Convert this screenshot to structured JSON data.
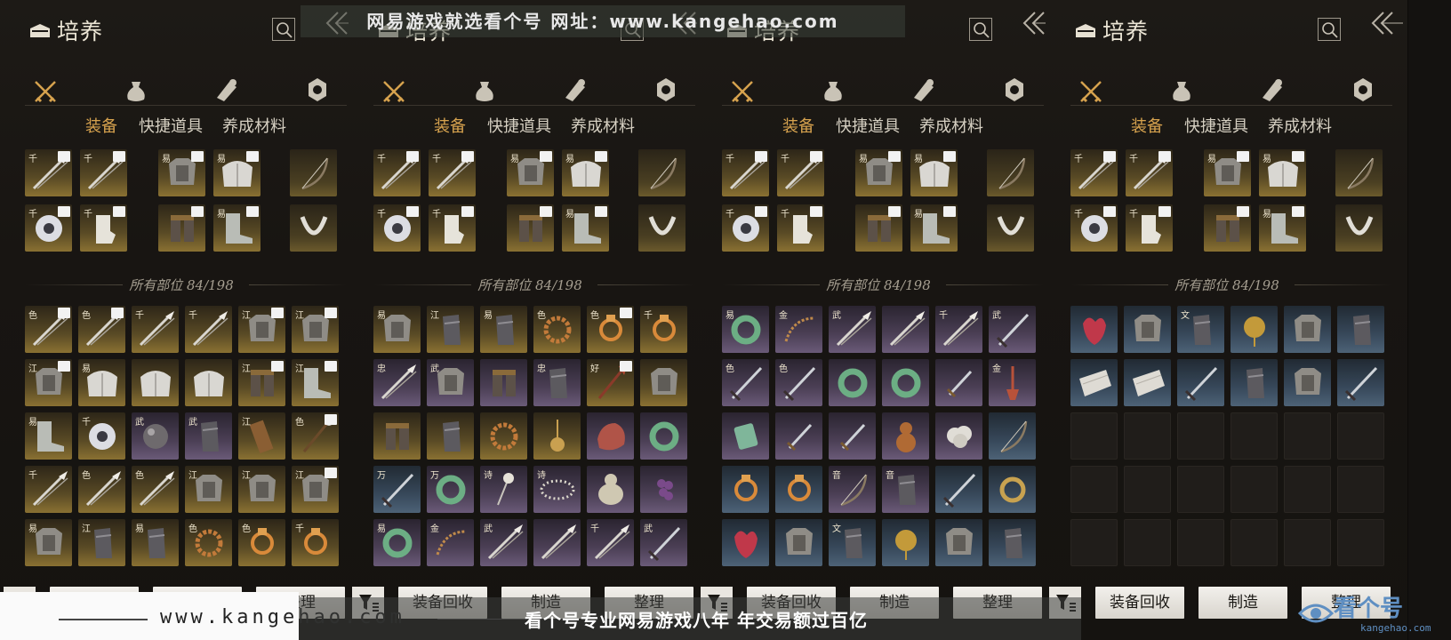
{
  "header": {
    "title": "培养"
  },
  "tabs": [
    "装备",
    "快捷道具",
    "养成材料"
  ],
  "active_tab": "装备",
  "slots_count": "所有部位 84/198",
  "buttons": {
    "recycle": "装备回收",
    "craft": "制造",
    "sort": "整理"
  },
  "watermarks": {
    "top": "网易游戏就选看个号   网址：www.kangehao.com",
    "url": "www.kangehao.com",
    "slogan": "看个号专业网易游戏八年  年交易额过百亿",
    "logo": "看个号",
    "logo_sub": "kangehao.com"
  },
  "category_icons": [
    "crossed-swords-icon",
    "pouch-icon",
    "scroll-icon",
    "coin-medal-icon"
  ],
  "equipped": [
    {
      "tag": "千",
      "item": "spear",
      "q": "gold",
      "lv": true
    },
    {
      "tag": "千",
      "item": "spear",
      "q": "gold",
      "lv": true
    },
    {
      "tag": "易",
      "item": "armor",
      "q": "gold",
      "lv": true
    },
    {
      "tag": "易",
      "item": "chest",
      "q": "gold",
      "lv": true
    },
    {
      "tag": "",
      "item": "bow",
      "q": "gold-dim",
      "lv": false
    },
    {
      "tag": "千",
      "item": "disc",
      "q": "gold",
      "lv": true
    },
    {
      "tag": "千",
      "item": "glove",
      "q": "gold",
      "lv": true
    },
    {
      "tag": "",
      "item": "legs",
      "q": "gold",
      "lv": true
    },
    {
      "tag": "易",
      "item": "boot",
      "q": "gold",
      "lv": true
    },
    {
      "tag": "",
      "item": "necklace",
      "q": "gold-dim",
      "lv": false
    }
  ],
  "inventory": [
    [
      {
        "tag": "色",
        "item": "spear",
        "q": "gold",
        "lv": true
      },
      {
        "tag": "色",
        "item": "spear",
        "q": "gold",
        "lv": true
      },
      {
        "tag": "千",
        "item": "spear",
        "q": "gold",
        "lv": false
      },
      {
        "tag": "千",
        "item": "spear",
        "q": "gold",
        "lv": false
      },
      {
        "tag": "江",
        "item": "armor",
        "q": "gold",
        "lv": true
      },
      {
        "tag": "江",
        "item": "armor",
        "q": "gold",
        "lv": true
      },
      {
        "tag": "江",
        "item": "armor",
        "q": "gold",
        "lv": true
      },
      {
        "tag": "易",
        "item": "chest",
        "q": "gold",
        "lv": false
      },
      {
        "tag": "",
        "item": "chest",
        "q": "gold",
        "lv": false
      },
      {
        "tag": "",
        "item": "chest",
        "q": "gold",
        "lv": false
      },
      {
        "tag": "江",
        "item": "legs",
        "q": "gold",
        "lv": true
      },
      {
        "tag": "江",
        "item": "boot",
        "q": "gold",
        "lv": true
      },
      {
        "tag": "易",
        "item": "boot",
        "q": "gold",
        "lv": false
      },
      {
        "tag": "千",
        "item": "disc",
        "q": "gold",
        "lv": false
      },
      {
        "tag": "武",
        "item": "orb",
        "q": "purple",
        "lv": false
      },
      {
        "tag": "武",
        "item": "bracer",
        "q": "purple",
        "lv": false
      },
      {
        "tag": "江",
        "item": "quiver",
        "q": "gold",
        "lv": false
      },
      {
        "tag": "色",
        "item": "staff",
        "q": "gold",
        "lv": true
      },
      {
        "tag": "千",
        "item": "spear",
        "q": "gold",
        "lv": false
      },
      {
        "tag": "色",
        "item": "spear",
        "q": "gold",
        "lv": false
      },
      {
        "tag": "色",
        "item": "spear",
        "q": "gold",
        "lv": false
      },
      {
        "tag": "江",
        "item": "armor",
        "q": "gold",
        "lv": false
      },
      {
        "tag": "江",
        "item": "armor",
        "q": "gold",
        "lv": false
      },
      {
        "tag": "江",
        "item": "armor",
        "q": "gold",
        "lv": true
      },
      {
        "tag": "易",
        "item": "armor",
        "q": "gold",
        "lv": false
      },
      {
        "tag": "江",
        "item": "bracer",
        "q": "gold",
        "lv": false
      },
      {
        "tag": "易",
        "item": "bracer",
        "q": "gold",
        "lv": false
      },
      {
        "tag": "色",
        "item": "bead",
        "q": "gold",
        "lv": false
      },
      {
        "tag": "色",
        "item": "ring",
        "q": "gold",
        "lv": false
      },
      {
        "tag": "千",
        "item": "ring",
        "q": "gold",
        "lv": false
      }
    ],
    [
      {
        "tag": "易",
        "item": "armor",
        "q": "gold",
        "lv": false
      },
      {
        "tag": "江",
        "item": "bracer",
        "q": "gold",
        "lv": false
      },
      {
        "tag": "易",
        "item": "bracer",
        "q": "gold",
        "lv": false
      },
      {
        "tag": "色",
        "item": "bead",
        "q": "gold",
        "lv": false
      },
      {
        "tag": "色",
        "item": "ring",
        "q": "gold",
        "lv": true
      },
      {
        "tag": "千",
        "item": "ring",
        "q": "gold",
        "lv": false
      },
      {
        "tag": "忠",
        "item": "spear",
        "q": "purple",
        "lv": false
      },
      {
        "tag": "武",
        "item": "armor",
        "q": "purple",
        "lv": false
      },
      {
        "tag": "",
        "item": "legs",
        "q": "purple",
        "lv": false
      },
      {
        "tag": "忠",
        "item": "bracer",
        "q": "purple",
        "lv": false
      },
      {
        "tag": "好",
        "item": "trident",
        "q": "gold",
        "lv": true
      },
      {
        "tag": "",
        "item": "armor",
        "q": "gold",
        "lv": false
      },
      {
        "tag": "",
        "item": "legs",
        "q": "gold",
        "lv": false
      },
      {
        "tag": "",
        "item": "bracer",
        "q": "gold",
        "lv": false
      },
      {
        "tag": "",
        "item": "bead",
        "q": "gold",
        "lv": false
      },
      {
        "tag": "",
        "item": "pendant",
        "q": "gold",
        "lv": false
      },
      {
        "tag": "",
        "item": "rock",
        "q": "purple",
        "lv": false
      },
      {
        "tag": "",
        "item": "jade",
        "q": "purple",
        "lv": false
      },
      {
        "tag": "万",
        "item": "sword",
        "q": "blue",
        "lv": false
      },
      {
        "tag": "万",
        "item": "jade",
        "q": "purple",
        "lv": false
      },
      {
        "tag": "诗",
        "item": "flower",
        "q": "purple",
        "lv": false
      },
      {
        "tag": "诗",
        "item": "necklace2",
        "q": "purple",
        "lv": false
      },
      {
        "tag": "",
        "item": "figure",
        "q": "purple",
        "lv": false
      },
      {
        "tag": "",
        "item": "grapes",
        "q": "purple",
        "lv": false
      },
      {
        "tag": "易",
        "item": "jade",
        "q": "purple",
        "lv": false
      },
      {
        "tag": "金",
        "item": "whip",
        "q": "purple",
        "lv": false
      },
      {
        "tag": "武",
        "item": "spear",
        "q": "purple",
        "lv": false
      },
      {
        "tag": "",
        "item": "spear",
        "q": "purple",
        "lv": false
      },
      {
        "tag": "千",
        "item": "spear",
        "q": "purple",
        "lv": false
      },
      {
        "tag": "武",
        "item": "sword",
        "q": "purple",
        "lv": false
      }
    ],
    [
      {
        "tag": "易",
        "item": "jade",
        "q": "purple",
        "lv": false
      },
      {
        "tag": "金",
        "item": "whip",
        "q": "purple",
        "lv": false
      },
      {
        "tag": "武",
        "item": "spear",
        "q": "purple",
        "lv": false
      },
      {
        "tag": "",
        "item": "spear",
        "q": "purple",
        "lv": false
      },
      {
        "tag": "千",
        "item": "spear",
        "q": "purple",
        "lv": false
      },
      {
        "tag": "武",
        "item": "sword",
        "q": "purple",
        "lv": false
      },
      {
        "tag": "色",
        "item": "sword",
        "q": "purple",
        "lv": false
      },
      {
        "tag": "色",
        "item": "sword",
        "q": "purple",
        "lv": false
      },
      {
        "tag": "",
        "item": "jade",
        "q": "purple",
        "lv": false
      },
      {
        "tag": "",
        "item": "jade",
        "q": "purple",
        "lv": false
      },
      {
        "tag": "",
        "item": "dagger",
        "q": "purple",
        "lv": false
      },
      {
        "tag": "金",
        "item": "tassel",
        "q": "purple",
        "lv": false
      },
      {
        "tag": "",
        "item": "pendant2",
        "q": "purple",
        "lv": false
      },
      {
        "tag": "",
        "item": "dagger",
        "q": "purple",
        "lv": false
      },
      {
        "tag": "",
        "item": "dagger",
        "q": "purple",
        "lv": false
      },
      {
        "tag": "",
        "item": "gourd",
        "q": "purple",
        "lv": false
      },
      {
        "tag": "",
        "item": "cloud",
        "q": "purple",
        "lv": false
      },
      {
        "tag": "",
        "item": "bow",
        "q": "blue",
        "lv": false
      },
      {
        "tag": "",
        "item": "ring",
        "q": "blue",
        "lv": false
      },
      {
        "tag": "",
        "item": "ring",
        "q": "blue",
        "lv": false
      },
      {
        "tag": "音",
        "item": "bow",
        "q": "purple",
        "lv": false
      },
      {
        "tag": "音",
        "item": "bracer",
        "q": "purple",
        "lv": false
      },
      {
        "tag": "",
        "item": "sword",
        "q": "blue",
        "lv": false
      },
      {
        "tag": "",
        "item": "ring2",
        "q": "blue",
        "lv": false
      },
      {
        "tag": "",
        "item": "redknot",
        "q": "blue",
        "lv": false
      },
      {
        "tag": "",
        "item": "armor",
        "q": "blue",
        "lv": false
      },
      {
        "tag": "文",
        "item": "bracer",
        "q": "blue",
        "lv": false
      },
      {
        "tag": "",
        "item": "flower2",
        "q": "blue",
        "lv": false
      },
      {
        "tag": "",
        "item": "armor",
        "q": "blue",
        "lv": false
      },
      {
        "tag": "",
        "item": "bracer",
        "q": "blue",
        "lv": false
      }
    ],
    [
      {
        "tag": "",
        "item": "redknot",
        "q": "blue",
        "lv": false
      },
      {
        "tag": "",
        "item": "armor",
        "q": "blue",
        "lv": false
      },
      {
        "tag": "文",
        "item": "bracer",
        "q": "blue",
        "lv": false
      },
      {
        "tag": "",
        "item": "flower2",
        "q": "blue",
        "lv": false
      },
      {
        "tag": "",
        "item": "armor",
        "q": "blue",
        "lv": false
      },
      {
        "tag": "",
        "item": "bracer",
        "q": "blue",
        "lv": false
      },
      {
        "tag": "",
        "item": "cloth",
        "q": "blue",
        "lv": false
      },
      {
        "tag": "",
        "item": "cloth",
        "q": "blue",
        "lv": false
      },
      {
        "tag": "",
        "item": "sword",
        "q": "blue",
        "lv": false
      },
      {
        "tag": "",
        "item": "bracer",
        "q": "blue",
        "lv": false
      },
      {
        "tag": "",
        "item": "armor",
        "q": "blue",
        "lv": false
      },
      {
        "tag": "",
        "item": "sword",
        "q": "blue",
        "lv": false
      },
      {
        "tag": "",
        "item": "",
        "q": "empty",
        "lv": false
      },
      {
        "tag": "",
        "item": "",
        "q": "empty",
        "lv": false
      },
      {
        "tag": "",
        "item": "",
        "q": "empty",
        "lv": false
      },
      {
        "tag": "",
        "item": "",
        "q": "empty",
        "lv": false
      },
      {
        "tag": "",
        "item": "",
        "q": "empty",
        "lv": false
      },
      {
        "tag": "",
        "item": "",
        "q": "empty",
        "lv": false
      },
      {
        "tag": "",
        "item": "",
        "q": "empty",
        "lv": false
      },
      {
        "tag": "",
        "item": "",
        "q": "empty",
        "lv": false
      },
      {
        "tag": "",
        "item": "",
        "q": "empty",
        "lv": false
      },
      {
        "tag": "",
        "item": "",
        "q": "empty",
        "lv": false
      },
      {
        "tag": "",
        "item": "",
        "q": "empty",
        "lv": false
      },
      {
        "tag": "",
        "item": "",
        "q": "empty",
        "lv": false
      },
      {
        "tag": "",
        "item": "",
        "q": "empty",
        "lv": false
      },
      {
        "tag": "",
        "item": "",
        "q": "empty",
        "lv": false
      },
      {
        "tag": "",
        "item": "",
        "q": "empty",
        "lv": false
      },
      {
        "tag": "",
        "item": "",
        "q": "empty",
        "lv": false
      },
      {
        "tag": "",
        "item": "",
        "q": "empty",
        "lv": false
      },
      {
        "tag": "",
        "item": "",
        "q": "empty",
        "lv": false
      }
    ]
  ]
}
